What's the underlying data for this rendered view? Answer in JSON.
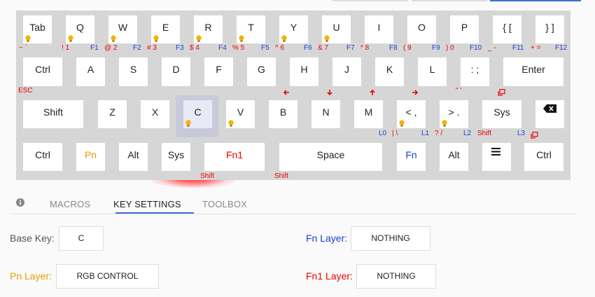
{
  "colors": {
    "red": "#e00000",
    "blue": "#1a3fd6",
    "yellow": "#e0a000",
    "accent": "#3f6bd6"
  },
  "keys": {
    "tab": "Tab",
    "q": "Q",
    "w": "W",
    "e": "E",
    "r": "R",
    "t": "T",
    "y": "Y",
    "u": "U",
    "i": "I",
    "o": "O",
    "p": "P",
    "lbracket": "{ [",
    "rbracket": "} ]",
    "ctrl": "Ctrl",
    "a": "A",
    "s": "S",
    "d": "D",
    "f": "F",
    "g": "G",
    "h": "H",
    "j": "J",
    "k": "K",
    "l": "L",
    "semicolon": ": ;",
    "enter": "Enter",
    "shift": "Shift",
    "z": "Z",
    "x": "X",
    "c": "C",
    "v": "V",
    "b": "B",
    "n": "N",
    "m": "M",
    "comma": "< ,",
    "period": "> .",
    "sys": "Sys",
    "ctrl2": "Ctrl",
    "pn": "Pn",
    "alt": "Alt",
    "sys2": "Sys",
    "fn1": "Fn1",
    "space": "Space",
    "fn": "Fn",
    "alt2": "Alt",
    "ctrl3": "Ctrl"
  },
  "sublabels": {
    "row1": [
      "~ `",
      "! 1",
      "F1",
      "@ 2",
      "F2",
      "# 3",
      "F3",
      "$ 4",
      "F4",
      "% 5",
      "F5",
      "^ 6",
      "F6",
      "& 7",
      "F7",
      "* 8",
      "F8",
      "( 9",
      "F9",
      ") 0",
      "F10",
      "_ -",
      "F11",
      "+ =",
      "F12"
    ],
    "esc": "ESC",
    "quote": "\" '",
    "row3": [
      "L0",
      "| \\",
      "L1",
      "? /",
      "L2",
      "Shift",
      "L3"
    ],
    "shift_a": "Shift",
    "shift_b": "Shift"
  },
  "tabs": {
    "info_icon": "info-icon",
    "macros": "MACROS",
    "key_settings": "KEY SETTINGS",
    "toolbox": "TOOLBOX"
  },
  "settings": {
    "base_key_label": "Base Key:",
    "base_key_value": "C",
    "fn_layer_label": "Fn Layer:",
    "fn_layer_value": "NOTHING",
    "pn_layer_label": "Pn Layer:",
    "pn_layer_value": "RGB CONTROL",
    "fn1_layer_label": "Fn1 Layer:",
    "fn1_layer_value": "NOTHING"
  }
}
